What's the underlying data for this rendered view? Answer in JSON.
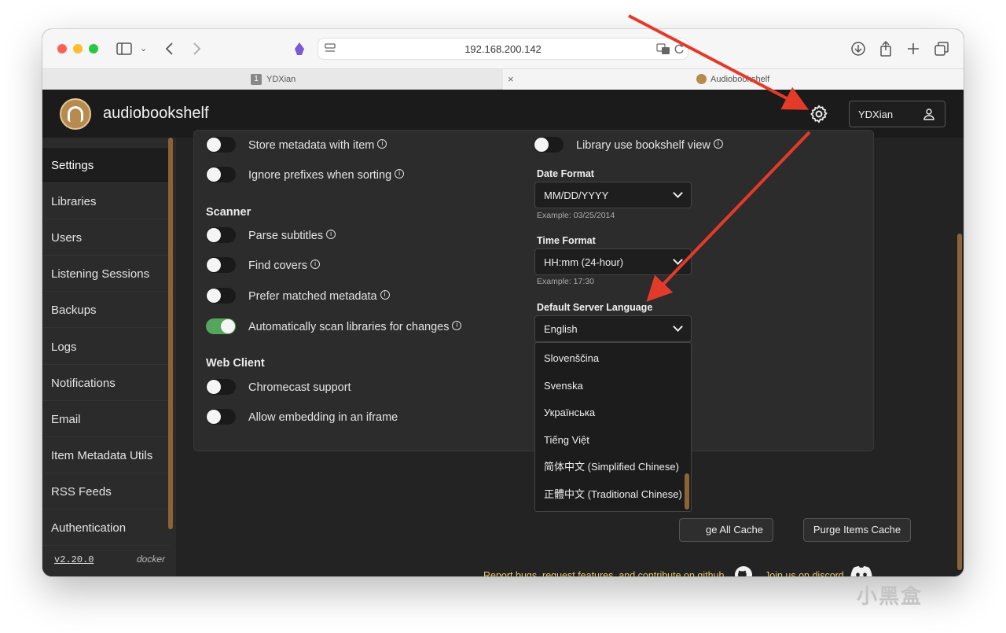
{
  "browser": {
    "url": "192.168.200.142",
    "tabs": [
      {
        "badge": "1",
        "label": "YDXian"
      },
      {
        "label": "Audiobookshelf"
      }
    ]
  },
  "app": {
    "title": "audiobookshelf",
    "user": "YDXian"
  },
  "sidebar": {
    "items": [
      {
        "label": "Settings"
      },
      {
        "label": "Libraries"
      },
      {
        "label": "Users"
      },
      {
        "label": "Listening Sessions"
      },
      {
        "label": "Backups"
      },
      {
        "label": "Logs"
      },
      {
        "label": "Notifications"
      },
      {
        "label": "Email"
      },
      {
        "label": "Item Metadata Utils"
      },
      {
        "label": "RSS Feeds"
      },
      {
        "label": "Authentication"
      }
    ],
    "version": "v2.20.0",
    "build": "docker"
  },
  "settings": {
    "left": {
      "store_metadata": "Store metadata with item",
      "ignore_prefixes": "Ignore prefixes when sorting",
      "scanner_heading": "Scanner",
      "parse_subtitles": "Parse subtitles",
      "find_covers": "Find covers",
      "prefer_matched": "Prefer matched metadata",
      "auto_scan": "Automatically scan libraries for changes",
      "web_client_heading": "Web Client",
      "chromecast": "Chromecast support",
      "iframe": "Allow embedding in an iframe"
    },
    "right": {
      "bookshelf_view": "Library use bookshelf view",
      "date_format_label": "Date Format",
      "date_format_value": "MM/DD/YYYY",
      "date_example": "Example: 03/25/2014",
      "time_format_label": "Time Format",
      "time_format_value": "HH:mm (24-hour)",
      "time_example": "Example: 17:30",
      "language_label": "Default Server Language",
      "language_value": "English",
      "language_options": [
        "Slovenščina",
        "Svenska",
        "Українська",
        "Tiếng Việt",
        "简体中文 (Simplified Chinese)",
        "正體中文 (Traditional Chinese)"
      ]
    },
    "toggles_on": {
      "auto_scan": true
    }
  },
  "actions": {
    "purge_all_cache": "ge All Cache",
    "purge_items_cache": "Purge Items Cache"
  },
  "footer": {
    "report_text": "Report bugs, request features, and contribute on",
    "github_link": "github",
    "discord_text": "Join us on",
    "discord_link": "discord"
  },
  "watermark": "小黑盒",
  "colors": {
    "accent": "#8c6237",
    "toggle_on": "#55a65a",
    "footer_link": "#e8c46a",
    "annotation_arrow": "#e23b2a"
  }
}
